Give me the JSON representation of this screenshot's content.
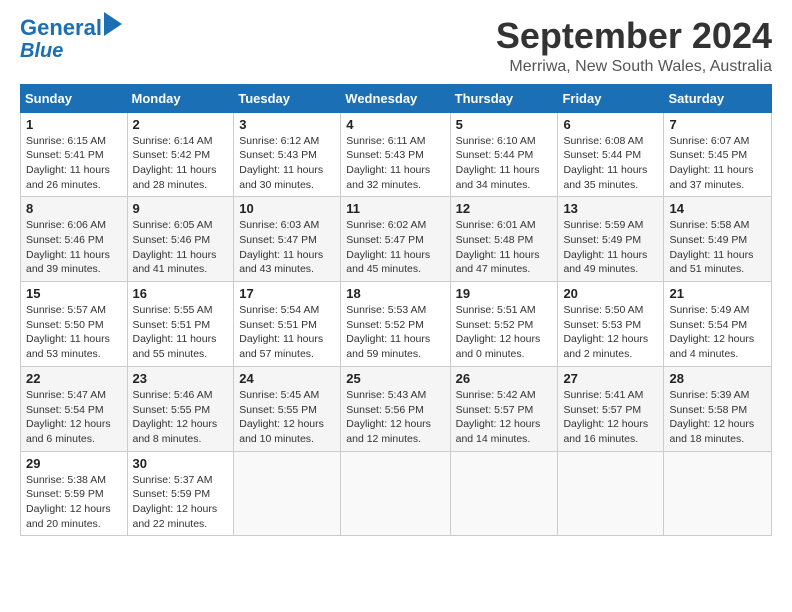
{
  "header": {
    "logo_line1": "General",
    "logo_line2": "Blue",
    "month": "September 2024",
    "location": "Merriwa, New South Wales, Australia"
  },
  "weekdays": [
    "Sunday",
    "Monday",
    "Tuesday",
    "Wednesday",
    "Thursday",
    "Friday",
    "Saturday"
  ],
  "weeks": [
    [
      {
        "day": "1",
        "rise": "6:15 AM",
        "set": "5:41 PM",
        "daylight": "11 hours and 26 minutes."
      },
      {
        "day": "2",
        "rise": "6:14 AM",
        "set": "5:42 PM",
        "daylight": "11 hours and 28 minutes."
      },
      {
        "day": "3",
        "rise": "6:12 AM",
        "set": "5:43 PM",
        "daylight": "11 hours and 30 minutes."
      },
      {
        "day": "4",
        "rise": "6:11 AM",
        "set": "5:43 PM",
        "daylight": "11 hours and 32 minutes."
      },
      {
        "day": "5",
        "rise": "6:10 AM",
        "set": "5:44 PM",
        "daylight": "11 hours and 34 minutes."
      },
      {
        "day": "6",
        "rise": "6:08 AM",
        "set": "5:44 PM",
        "daylight": "11 hours and 35 minutes."
      },
      {
        "day": "7",
        "rise": "6:07 AM",
        "set": "5:45 PM",
        "daylight": "11 hours and 37 minutes."
      }
    ],
    [
      {
        "day": "8",
        "rise": "6:06 AM",
        "set": "5:46 PM",
        "daylight": "11 hours and 39 minutes."
      },
      {
        "day": "9",
        "rise": "6:05 AM",
        "set": "5:46 PM",
        "daylight": "11 hours and 41 minutes."
      },
      {
        "day": "10",
        "rise": "6:03 AM",
        "set": "5:47 PM",
        "daylight": "11 hours and 43 minutes."
      },
      {
        "day": "11",
        "rise": "6:02 AM",
        "set": "5:47 PM",
        "daylight": "11 hours and 45 minutes."
      },
      {
        "day": "12",
        "rise": "6:01 AM",
        "set": "5:48 PM",
        "daylight": "11 hours and 47 minutes."
      },
      {
        "day": "13",
        "rise": "5:59 AM",
        "set": "5:49 PM",
        "daylight": "11 hours and 49 minutes."
      },
      {
        "day": "14",
        "rise": "5:58 AM",
        "set": "5:49 PM",
        "daylight": "11 hours and 51 minutes."
      }
    ],
    [
      {
        "day": "15",
        "rise": "5:57 AM",
        "set": "5:50 PM",
        "daylight": "11 hours and 53 minutes."
      },
      {
        "day": "16",
        "rise": "5:55 AM",
        "set": "5:51 PM",
        "daylight": "11 hours and 55 minutes."
      },
      {
        "day": "17",
        "rise": "5:54 AM",
        "set": "5:51 PM",
        "daylight": "11 hours and 57 minutes."
      },
      {
        "day": "18",
        "rise": "5:53 AM",
        "set": "5:52 PM",
        "daylight": "11 hours and 59 minutes."
      },
      {
        "day": "19",
        "rise": "5:51 AM",
        "set": "5:52 PM",
        "daylight": "12 hours and 0 minutes."
      },
      {
        "day": "20",
        "rise": "5:50 AM",
        "set": "5:53 PM",
        "daylight": "12 hours and 2 minutes."
      },
      {
        "day": "21",
        "rise": "5:49 AM",
        "set": "5:54 PM",
        "daylight": "12 hours and 4 minutes."
      }
    ],
    [
      {
        "day": "22",
        "rise": "5:47 AM",
        "set": "5:54 PM",
        "daylight": "12 hours and 6 minutes."
      },
      {
        "day": "23",
        "rise": "5:46 AM",
        "set": "5:55 PM",
        "daylight": "12 hours and 8 minutes."
      },
      {
        "day": "24",
        "rise": "5:45 AM",
        "set": "5:55 PM",
        "daylight": "12 hours and 10 minutes."
      },
      {
        "day": "25",
        "rise": "5:43 AM",
        "set": "5:56 PM",
        "daylight": "12 hours and 12 minutes."
      },
      {
        "day": "26",
        "rise": "5:42 AM",
        "set": "5:57 PM",
        "daylight": "12 hours and 14 minutes."
      },
      {
        "day": "27",
        "rise": "5:41 AM",
        "set": "5:57 PM",
        "daylight": "12 hours and 16 minutes."
      },
      {
        "day": "28",
        "rise": "5:39 AM",
        "set": "5:58 PM",
        "daylight": "12 hours and 18 minutes."
      }
    ],
    [
      {
        "day": "29",
        "rise": "5:38 AM",
        "set": "5:59 PM",
        "daylight": "12 hours and 20 minutes."
      },
      {
        "day": "30",
        "rise": "5:37 AM",
        "set": "5:59 PM",
        "daylight": "12 hours and 22 minutes."
      },
      null,
      null,
      null,
      null,
      null
    ]
  ]
}
